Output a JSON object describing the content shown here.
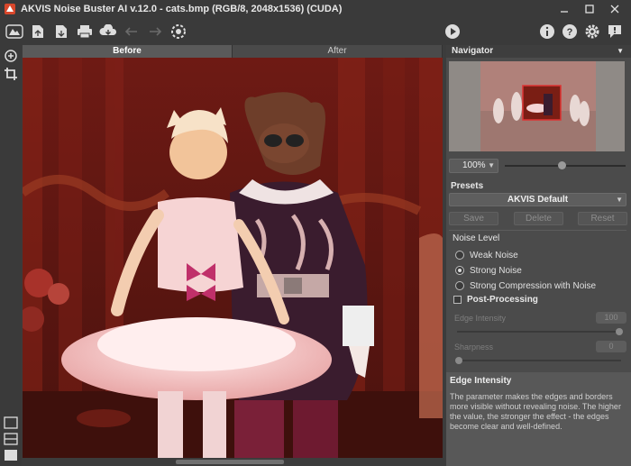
{
  "window": {
    "title": "AKVIS Noise Buster AI v.12.0 - cats.bmp (RGB/8, 2048x1536) (CUDA)",
    "controls": [
      "minimize",
      "maximize",
      "close"
    ]
  },
  "toolbar": {
    "left_icons": [
      "home-icon",
      "open-file-icon",
      "save-file-icon",
      "print-icon",
      "share-icon",
      "undo-icon",
      "redo-icon",
      "preferences-icon"
    ],
    "run_icon": "run-icon",
    "right_icons": [
      "info-icon",
      "help-icon",
      "settings-icon",
      "notifications-icon"
    ]
  },
  "view_tabs": [
    {
      "label": "Before",
      "active": true
    },
    {
      "label": "After",
      "active": false
    }
  ],
  "navigator": {
    "title": "Navigator",
    "zoom": "100%",
    "zoom_slider_value": 0.47
  },
  "presets": {
    "label": "Presets",
    "selected": "AKVIS Default",
    "save_label": "Save",
    "delete_label": "Delete",
    "reset_label": "Reset"
  },
  "noise_level": {
    "label": "Noise Level",
    "options": [
      {
        "label": "Weak Noise",
        "selected": false
      },
      {
        "label": "Strong Noise",
        "selected": true
      },
      {
        "label": "Strong Compression with Noise",
        "selected": false
      }
    ]
  },
  "post_processing": {
    "label": "Post-Processing",
    "checked": false,
    "edge_intensity_label": "Edge Intensity",
    "edge_intensity_value": "100",
    "sharpness_label": "Sharpness",
    "sharpness_value": "0"
  },
  "help": {
    "title": "Edge Intensity",
    "text": "The parameter makes the edges and borders more visible without revealing noise. The higher the value, the stronger the effect - the edges become clear and well-defined."
  },
  "colors": {
    "background": "#3c3c3c",
    "panel": "#4b4b4b",
    "photo_tint": "#8a2a1e"
  }
}
